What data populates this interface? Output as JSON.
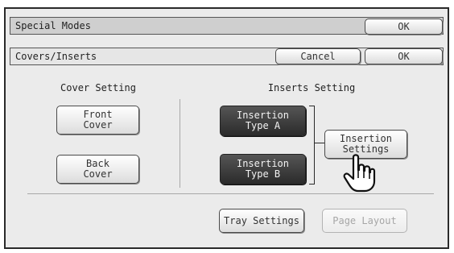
{
  "header": {
    "title": "Special Modes",
    "ok_label": "OK"
  },
  "subheader": {
    "title": "Covers/Inserts",
    "cancel_label": "Cancel",
    "ok_label": "OK"
  },
  "cover": {
    "heading": "Cover Setting",
    "front_label_1": "Front",
    "front_label_2": "Cover",
    "back_label_1": "Back",
    "back_label_2": "Cover"
  },
  "inserts": {
    "heading": "Inserts Setting",
    "type_a_1": "Insertion",
    "type_a_2": "Type A",
    "type_b_1": "Insertion",
    "type_b_2": "Type B",
    "settings_1": "Insertion",
    "settings_2": "Settings"
  },
  "footer": {
    "tray_settings_label": "Tray Settings",
    "page_layout_label": "Page Layout"
  },
  "icons": {
    "cursor": "hand-pointer-icon"
  }
}
